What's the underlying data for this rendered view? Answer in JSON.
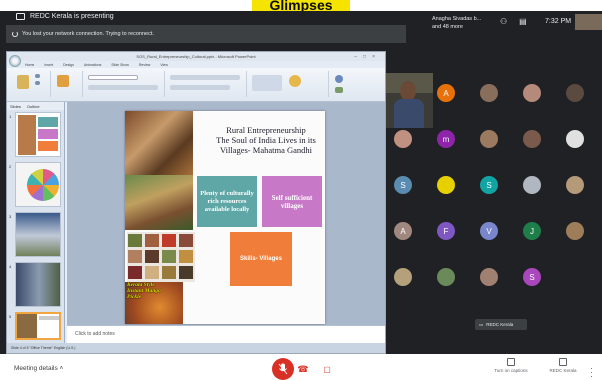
{
  "banner": {
    "title": "Glimpses"
  },
  "meet": {
    "presenting_text": "REDC Kerala is presenting",
    "connection_text": "You lost your network connection. Trying to reconnect.",
    "user_name": "Anagha Sivadas b...",
    "user_sub": "and 48 more",
    "clock": "7:32 PM",
    "pinned_name": "REDC Kerala"
  },
  "ppt": {
    "window_title": "SOS_Rural_Entrepreneurship_Cultural.pptx - Microsoft PowerPoint",
    "tabs": [
      "Home",
      "Insert",
      "Design",
      "Animations",
      "Slide Show",
      "Review",
      "View"
    ],
    "pane_tabs": [
      "Slides",
      "Outline"
    ],
    "notes_placeholder": "Click to add notes",
    "status": "Slide 4 of 5   \"Office Theme\"   English (U.S.)"
  },
  "slide": {
    "heading_lines": [
      "Rural Entrepreneurship",
      "The Soul of India Lives in its",
      "Villages- Mahatma Gandhi"
    ],
    "box_teal": "Plenty of culturally rich resources available locally",
    "box_purple": "Self sufficient villages",
    "box_orange": "Skills- Villages",
    "caption": "Kerala Style Instant Mango Pickle"
  },
  "participants": [
    {
      "type": "letter",
      "letter": "A",
      "color": "#e8710a"
    },
    {
      "type": "photo",
      "color": "#8a6e5c"
    },
    {
      "type": "photo",
      "color": "#b58a7a"
    },
    {
      "type": "photo",
      "color": "#5a4a40"
    },
    {
      "type": "photo",
      "color": "#c09080"
    },
    {
      "type": "letter",
      "letter": "m",
      "color": "#8e24aa"
    },
    {
      "type": "photo",
      "color": "#9b7a60"
    },
    {
      "type": "photo",
      "color": "#7a5a4a"
    },
    {
      "type": "photo",
      "color": "#e0e0e0"
    },
    {
      "type": "letter",
      "letter": "S",
      "color": "#5a8bb0"
    },
    {
      "type": "photo",
      "color": "#e7d000"
    },
    {
      "type": "letter",
      "letter": "S",
      "color": "#12a3a3"
    },
    {
      "type": "photo",
      "color": "#b0b7c0"
    },
    {
      "type": "photo",
      "color": "#b59a7a"
    },
    {
      "type": "letter",
      "letter": "A",
      "color": "#a1887f"
    },
    {
      "type": "letter",
      "letter": "F",
      "color": "#7e57c2"
    },
    {
      "type": "letter",
      "letter": "V",
      "color": "#7986cb"
    },
    {
      "type": "letter",
      "letter": "J",
      "color": "#1e7e4a"
    },
    {
      "type": "photo",
      "color": "#9e7e5a"
    },
    {
      "type": "photo",
      "color": "#b4a07a"
    },
    {
      "type": "photo",
      "color": "#6a8a5a"
    },
    {
      "type": "photo",
      "color": "#a08070"
    },
    {
      "type": "letter",
      "letter": "S",
      "color": "#ab47bc"
    }
  ],
  "bottom": {
    "meeting_details": "Meeting details",
    "action_turn_on_captions": "Turn on captions",
    "action_presenter": "REDC Kerala"
  },
  "colors": {
    "banner_bg": "#f5e400",
    "meet_bg": "#202124",
    "end_call": "#d93025"
  }
}
